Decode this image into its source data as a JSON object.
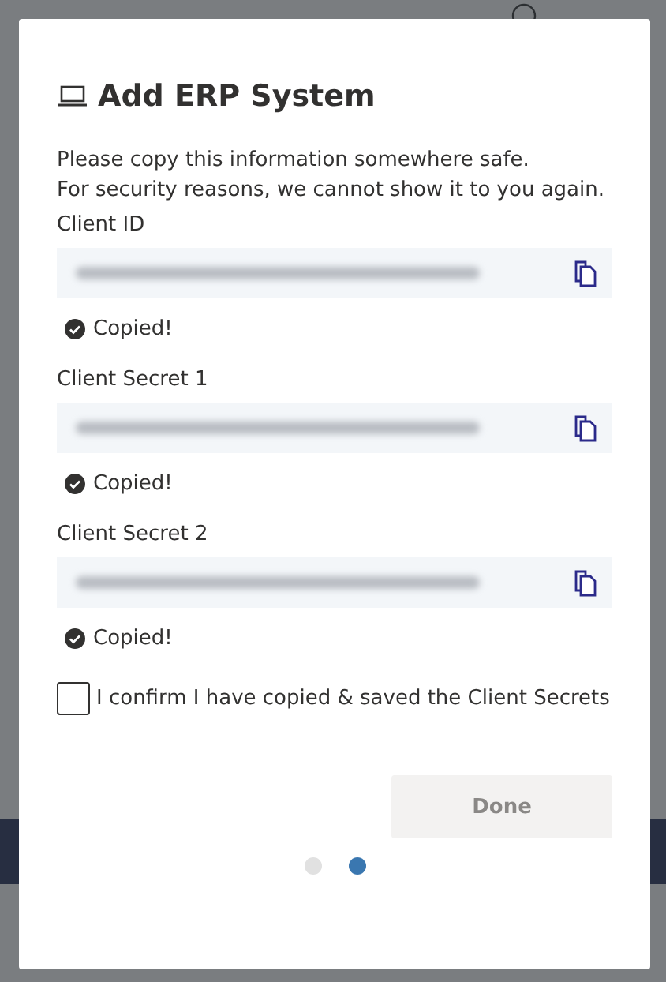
{
  "dialog": {
    "title": "Add ERP System",
    "intro": [
      "Please copy this information somewhere safe.",
      "For security reasons, we cannot show it to you again."
    ],
    "fields": [
      {
        "label": "Client ID",
        "status": "Copied!"
      },
      {
        "label": "Client Secret 1",
        "status": "Copied!"
      },
      {
        "label": "Client Secret 2",
        "status": "Copied!"
      }
    ],
    "confirm": {
      "label": "I confirm I have copied & saved the Client Secrets",
      "checked": false
    },
    "done_button": {
      "label": "Done",
      "disabled": true
    },
    "steps": [
      {
        "selected": false
      },
      {
        "selected": true
      }
    ]
  }
}
